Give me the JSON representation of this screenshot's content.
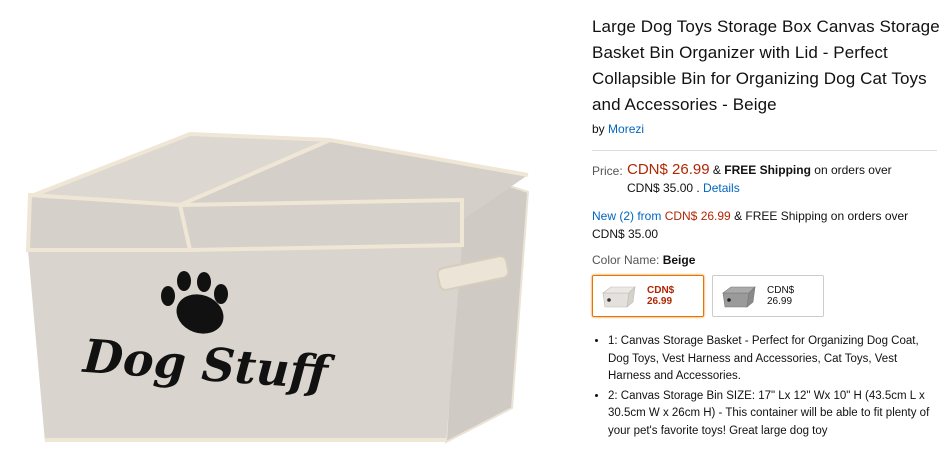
{
  "product": {
    "title": "Large Dog Toys Storage Box Canvas Storage Basket Bin Organizer with Lid - Perfect Collapsible Bin for Organizing Dog Cat Toys and Accessories - Beige",
    "by_prefix": "by",
    "brand": "Morezi",
    "image_caption": "Dog Stuff"
  },
  "price": {
    "label": "Price:",
    "amount": "CDN$ 26.99",
    "separator": "&",
    "free_shipping": "FREE Shipping",
    "shipping_suffix": "on orders over",
    "threshold": "CDN$ 35.00 .",
    "details_link": "Details"
  },
  "offer": {
    "new_link": "New (2) from",
    "amount": "CDN$ 26.99",
    "text": "& FREE Shipping on orders over CDN$ 35.00"
  },
  "color": {
    "label": "Color Name:",
    "selected": "Beige",
    "swatches": [
      {
        "price": "CDN$ 26.99",
        "selected": true,
        "color": "#e4e0dc"
      },
      {
        "price": "CDN$ 26.99",
        "selected": false,
        "color": "#9a9a9a"
      }
    ]
  },
  "bullets": [
    "1: Canvas Storage Basket - Perfect for Organizing Dog Coat, Dog Toys, Vest Harness and Accessories, Cat Toys, Vest Harness and Accessories.",
    "2: Canvas Storage Bin SIZE: 17\" Lx 12\" Wx 10\" H (43.5cm L x 30.5cm W x 26cm H) - This container will be able to fit plenty of your pet's favorite toys! Great large dog toy"
  ],
  "colors": {
    "price_red": "#b12704",
    "link_blue": "#0066c0",
    "selected_border": "#e77600",
    "canvas_beige": "#d8d3cd"
  }
}
